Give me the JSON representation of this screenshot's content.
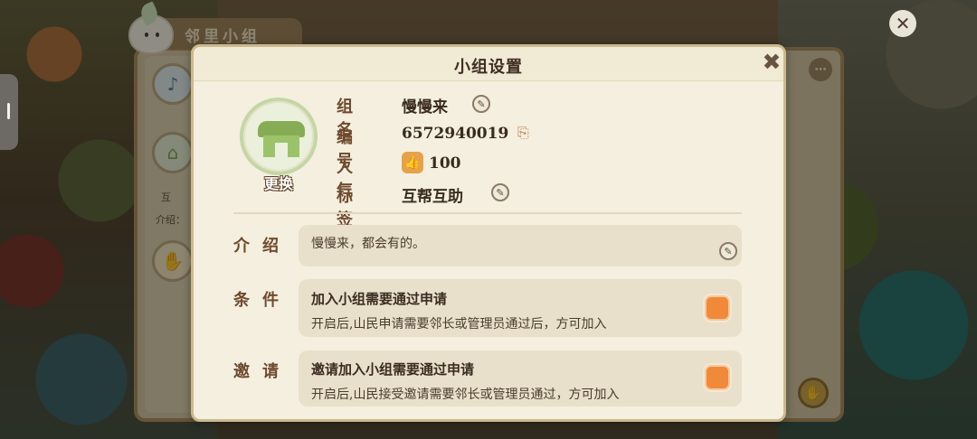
{
  "background": {
    "group_panel_title": "邻里小组",
    "group_side_text_1": "互",
    "group_side_text_2": "介绍：",
    "close_glyph": "✕",
    "more_glyph": "⋯",
    "handshake_icon": "handshake-icon"
  },
  "dialog": {
    "title": "小组设置",
    "close_glyph": "✖",
    "avatar": {
      "change_label": "更换",
      "icon": "hut-icon"
    },
    "info": {
      "name_label": "组名",
      "name_value": "慢慢来",
      "id_label": "编号",
      "id_value": "6572940019",
      "popularity_label": "人气",
      "popularity_value": "100",
      "tag_label": "标签",
      "tag_value": "互帮互助"
    },
    "intro": {
      "label": "介绍",
      "text": "慢慢来，都会有的。"
    },
    "condition": {
      "label": "条件",
      "title": "加入小组需要通过申请",
      "description": "开启后,山民申请需要邻长或管理员通过后，方可加入",
      "enabled": true
    },
    "invite": {
      "label": "邀请",
      "title": "邀请加入小组需要通过申请",
      "description": "开启后,山民接受邀请需要邻长或管理员通过，方可加入",
      "enabled": true
    }
  },
  "colors": {
    "toggle_on": "#f0893a",
    "label_brown": "#6e4a2e",
    "dialog_bg": "#f4efdf"
  }
}
